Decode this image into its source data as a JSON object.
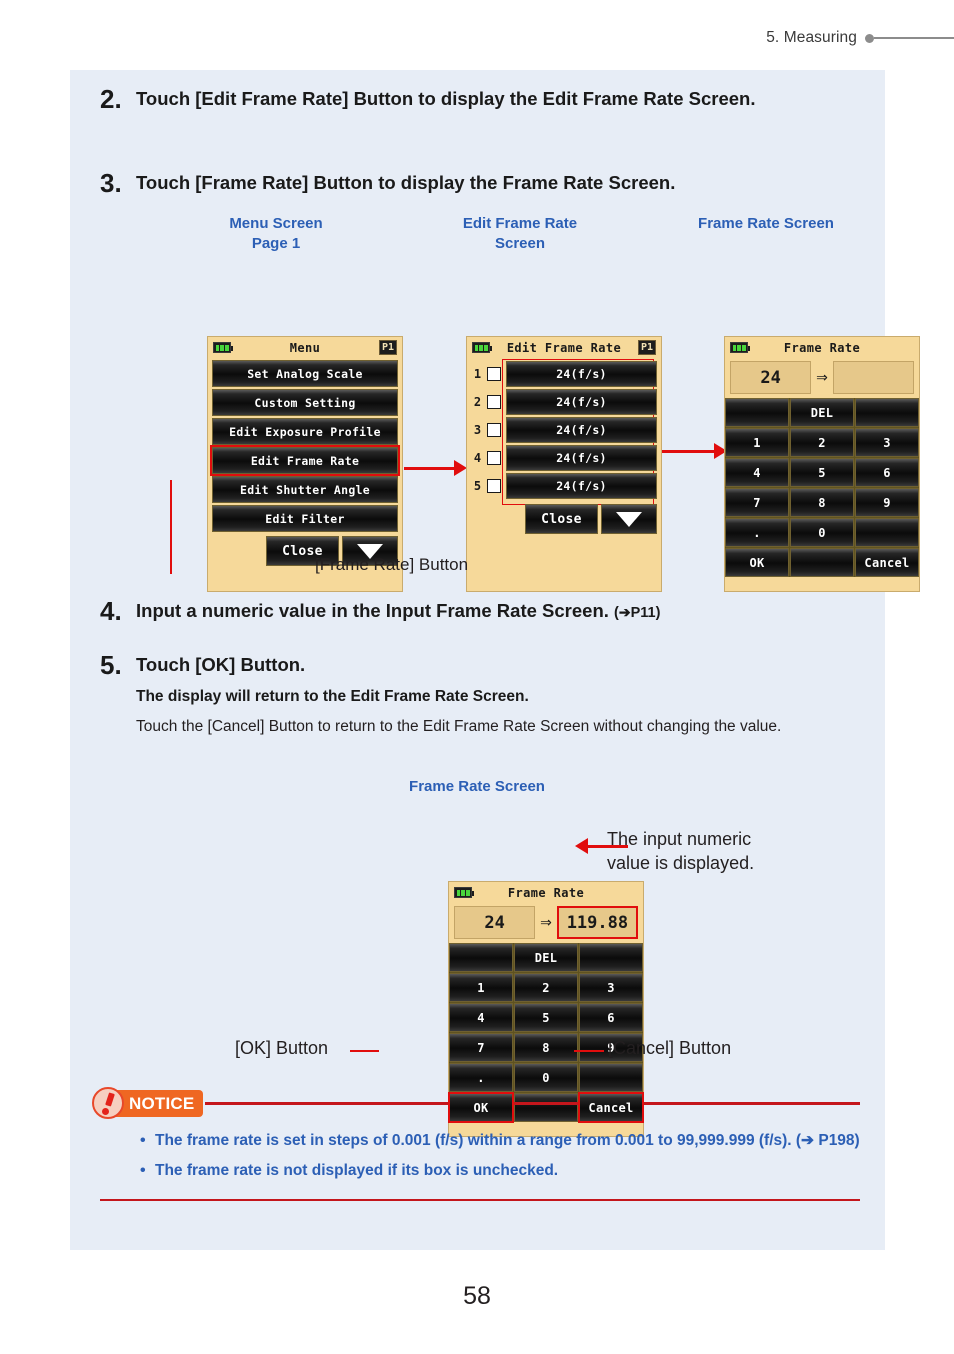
{
  "header": {
    "chapter": "5.  Measuring"
  },
  "page_number": "58",
  "steps": {
    "two": {
      "num": "2.",
      "text": "Touch [Edit Frame Rate] Button to display the Edit Frame Rate Screen."
    },
    "three": {
      "num": "3.",
      "text": "Touch [Frame Rate] Button to display the Frame Rate Screen."
    },
    "four": {
      "num": "4.",
      "text": "Input a numeric value in the Input Frame Rate Screen.",
      "ref_arrow": "➔",
      "ref": "P11"
    },
    "five": {
      "num": "5.",
      "text": "Touch [OK] Button.",
      "sub_bold": "The display will return to the Edit Frame Rate Screen.",
      "sub_plain": "Touch the [Cancel] Button to return to the Edit Frame Rate Screen without changing the value."
    }
  },
  "captions": {
    "menu_screen": "Menu Screen\nPage 1",
    "menu_screen_l1": "Menu Screen",
    "menu_screen_l2": "Page 1",
    "edit_frame_rate_l1": "Edit Frame Rate",
    "edit_frame_rate_l2": "Screen",
    "frame_rate_screen": "Frame Rate Screen",
    "frame_rate_screen_bottom": "Frame Rate Screen"
  },
  "callouts": {
    "frame_rate_button": "[Frame Rate] Button",
    "input_value_l1": "The input numeric",
    "input_value_l2": "value is displayed.",
    "ok_button": "[OK] Button",
    "cancel_button": "[Cancel] Button"
  },
  "menu_screen": {
    "title": "Menu",
    "page_badge": "P1",
    "items": [
      "Set Analog Scale",
      "Custom Setting",
      "Edit Exposure Profile",
      "Edit Frame Rate",
      "Edit Shutter Angle",
      "Edit Filter"
    ],
    "highlighted_item": "Edit Frame Rate",
    "close_label": "Close",
    "down_icon": "triangle-down-icon"
  },
  "edit_frame_rate_screen": {
    "title": "Edit Frame Rate",
    "page_badge": "P1",
    "rows": [
      {
        "index": "1",
        "checked": false,
        "value": "24(f/s)"
      },
      {
        "index": "2",
        "checked": false,
        "value": "24(f/s)"
      },
      {
        "index": "3",
        "checked": false,
        "value": "24(f/s)"
      },
      {
        "index": "4",
        "checked": false,
        "value": "24(f/s)"
      },
      {
        "index": "5",
        "checked": false,
        "value": "24(f/s)"
      }
    ],
    "close_label": "Close",
    "down_icon": "triangle-down-icon"
  },
  "frame_rate_screen_top": {
    "title": "Frame Rate",
    "current_value": "24",
    "separator": "⇒",
    "new_value": "",
    "keys": [
      "",
      "DEL",
      "",
      "1",
      "2",
      "3",
      "4",
      "5",
      "6",
      "7",
      "8",
      "9",
      ".",
      "0",
      "",
      "OK",
      "",
      "Cancel"
    ]
  },
  "frame_rate_screen_bottom": {
    "title": "Frame Rate",
    "current_value": "24",
    "separator": "⇒",
    "new_value": "119.88",
    "keys": [
      "",
      "DEL",
      "",
      "1",
      "2",
      "3",
      "4",
      "5",
      "6",
      "7",
      "8",
      "9",
      ".",
      "0",
      "",
      "OK",
      "",
      "Cancel"
    ],
    "highlighted_keys": [
      "OK",
      "Cancel"
    ]
  },
  "notice": {
    "label": "NOTICE",
    "items": [
      "The frame rate is set in steps of 0.001 (f/s) within a range from 0.001 to 99,999.999 (f/s). (➔ P198)",
      "The frame rate is not displayed if its box is unchecked."
    ]
  },
  "colors": {
    "panel_bg": "#e7edf6",
    "caption_blue": "#2c5fb5",
    "annotation_red": "#e10d0d",
    "notice_orange": "#ef6722",
    "notice_rule": "#c4161c",
    "device_bg": "#f6d99a",
    "value_box": "#e6c88a"
  }
}
